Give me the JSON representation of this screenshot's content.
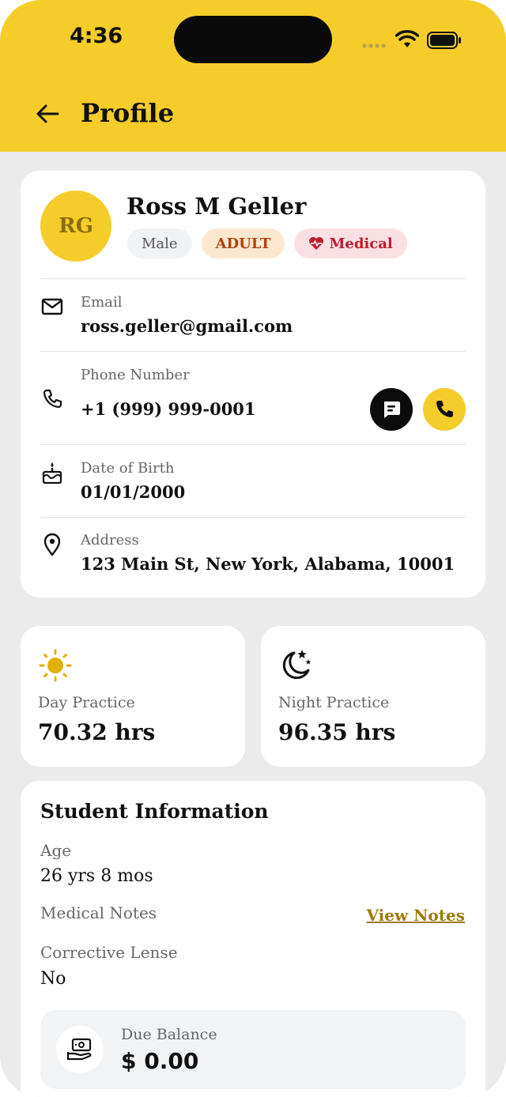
{
  "status_bar": {
    "time": "4:36"
  },
  "header": {
    "title": "Profile"
  },
  "profile": {
    "initials": "RG",
    "name": "Ross M Geller",
    "chips": {
      "gender": "Male",
      "age_group": "ADULT",
      "medical": "Medical"
    },
    "email": {
      "label": "Email",
      "value": "ross.geller@gmail.com"
    },
    "phone": {
      "label": "Phone Number",
      "value": "+1 (999) 999-0001"
    },
    "dob": {
      "label": "Date of Birth",
      "value": "01/01/2000"
    },
    "address": {
      "label": "Address",
      "value": "123 Main St, New York, Alabama, 10001"
    }
  },
  "practice": {
    "day": {
      "label": "Day Practice",
      "value": "70.32 hrs"
    },
    "night": {
      "label": "Night Practice",
      "value": "96.35 hrs"
    }
  },
  "student": {
    "title": "Student Information",
    "age": {
      "label": "Age",
      "value": "26 yrs 8 mos"
    },
    "medical_notes": {
      "label": "Medical Notes",
      "link": "View Notes"
    },
    "lense": {
      "label": "Corrective Lense",
      "value": "No"
    },
    "balance": {
      "label": "Due Balance",
      "value": "$ 0.00"
    }
  },
  "colors": {
    "accent": "#f5cd2a",
    "background": "#ebebeb",
    "link": "#9c7a05"
  },
  "icons": [
    "back-arrow-icon",
    "mail-icon",
    "phone-icon",
    "chat-icon",
    "call-icon",
    "cake-icon",
    "location-pin-icon",
    "sun-icon",
    "moon-stars-icon",
    "cash-hand-icon",
    "heart-pulse-icon"
  ]
}
